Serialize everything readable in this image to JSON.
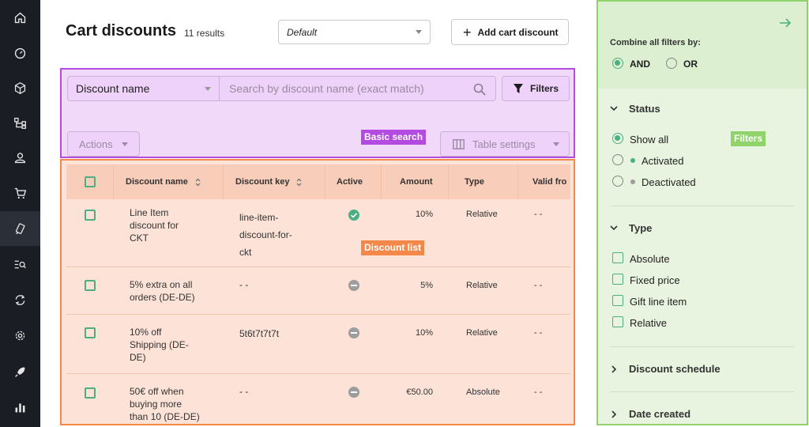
{
  "nav": {
    "items": [
      {
        "icon": "home-icon"
      },
      {
        "icon": "dashboard-icon"
      },
      {
        "icon": "products-icon"
      },
      {
        "icon": "categories-icon"
      },
      {
        "icon": "customers-icon"
      },
      {
        "icon": "orders-icon"
      },
      {
        "icon": "discounts-icon"
      },
      {
        "icon": "search-content-icon"
      },
      {
        "icon": "operations-icon"
      },
      {
        "icon": "settings-icon"
      },
      {
        "icon": "launch-icon"
      },
      {
        "icon": "analytics-icon"
      }
    ]
  },
  "header": {
    "title": "Cart discounts",
    "results": "11 results",
    "view_select": "Default",
    "add_button": "Add cart discount"
  },
  "search": {
    "field_select": "Discount name",
    "placeholder": "Search by discount name (exact match)",
    "filters_button": "Filters",
    "actions_button": "Actions",
    "table_settings_button": "Table settings",
    "annotation": "Basic search"
  },
  "table": {
    "annotation": "Discount list",
    "columns": [
      "Discount name",
      "Discount key",
      "Active",
      "Amount",
      "Type",
      "Valid fro"
    ],
    "rows": [
      {
        "name": [
          "Line Item",
          "discount for",
          "CKT"
        ],
        "key": [
          "line-item-",
          "discount-for-",
          "ckt"
        ],
        "active": true,
        "amount": "10%",
        "type": "Relative",
        "valid_from": "- -"
      },
      {
        "name": [
          "5% extra on all",
          "orders (DE-DE)"
        ],
        "key": [
          "- -"
        ],
        "active": false,
        "amount": "5%",
        "type": "Relative",
        "valid_from": "- -"
      },
      {
        "name": [
          "10% off",
          "Shipping (DE-",
          "DE)"
        ],
        "key": [
          "5t6t7t7t7t"
        ],
        "active": false,
        "amount": "10%",
        "type": "Relative",
        "valid_from": "- -"
      },
      {
        "name": [
          "50€ off when",
          "buying more",
          "than 10 (DE-DE)"
        ],
        "key": [
          "- -"
        ],
        "active": false,
        "amount": "€50.00",
        "type": "Absolute",
        "valid_from": "- -"
      }
    ]
  },
  "filters": {
    "annotation": "Filters",
    "combine_label": "Combine all filters by:",
    "combine_options": [
      "AND",
      "OR"
    ],
    "combine_selected": "AND",
    "status": {
      "title": "Status",
      "options": [
        "Show all",
        "Activated",
        "Deactivated"
      ],
      "selected": "Show all",
      "colors": {
        "Activated": "#4caf82",
        "Deactivated": "#9d9d9d"
      }
    },
    "type": {
      "title": "Type",
      "options": [
        "Absolute",
        "Fixed price",
        "Gift line item",
        "Relative"
      ]
    },
    "schedule_title": "Discount schedule",
    "date_created_title": "Date created"
  },
  "colors": {
    "search_border": "#b44be0",
    "list_border": "#f4884a",
    "filters_border": "#8fd36a",
    "accent": "#4caf82"
  }
}
